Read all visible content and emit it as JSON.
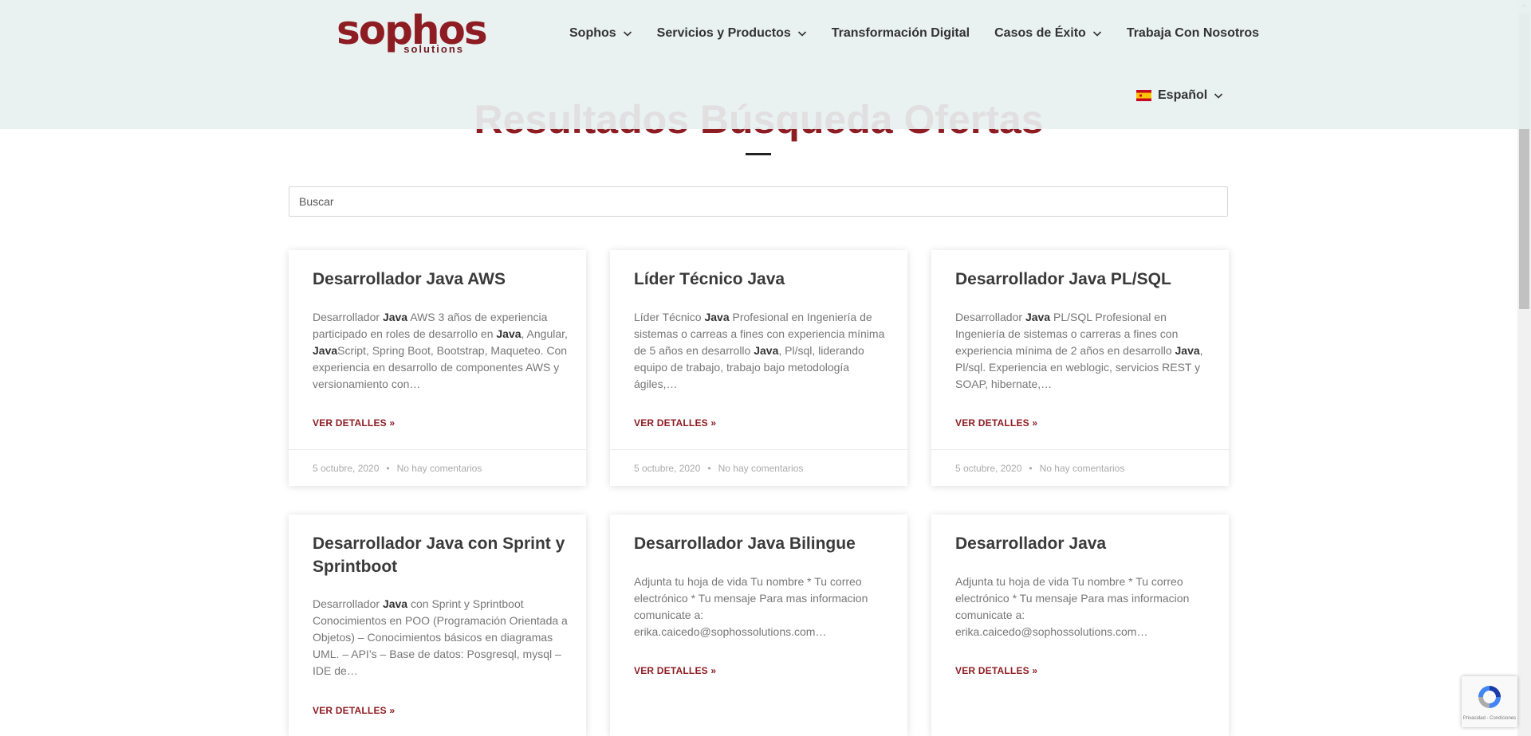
{
  "header": {
    "logo_text": "sophos",
    "logo_subtext": "solutions",
    "nav": [
      {
        "label": "Sophos",
        "dropdown": true
      },
      {
        "label": "Servicios y Productos",
        "dropdown": true
      },
      {
        "label": "Transformación Digital",
        "dropdown": false
      },
      {
        "label": "Casos de Éxito",
        "dropdown": true
      },
      {
        "label": "Trabaja Con Nosotros",
        "dropdown": false
      }
    ],
    "language": "Español"
  },
  "page": {
    "title": "Resultados Búsqueda Ofertas"
  },
  "search": {
    "placeholder": "Buscar"
  },
  "cards": [
    {
      "title": "Desarrollador Java AWS",
      "excerpt": [
        {
          "t": "Desarrollador "
        },
        {
          "t": "Java",
          "b": true
        },
        {
          "t": " AWS 3 años de experiencia participado en roles de desarrollo en "
        },
        {
          "t": "Java",
          "b": true
        },
        {
          "t": ", Angular, "
        },
        {
          "t": "Java",
          "b": true
        },
        {
          "t": "Script, Spring Boot, Bootstrap, Maqueteo. Con experiencia en desarrollo de componentes AWS y versionamiento con…"
        }
      ],
      "read_more": "VER DETALLES »",
      "date": "5 octubre, 2020",
      "comments": "No hay comentarios"
    },
    {
      "title": "Líder Técnico Java",
      "excerpt": [
        {
          "t": "Líder Técnico "
        },
        {
          "t": "Java",
          "b": true
        },
        {
          "t": " Profesional en Ingeniería de sistemas o carreas a fines con experiencia mínima de 5 años en desarrollo "
        },
        {
          "t": "Java",
          "b": true
        },
        {
          "t": ", Pl/sql, liderando equipo de trabajo, trabajo bajo metodología ágiles,…"
        }
      ],
      "read_more": "VER DETALLES »",
      "date": "5 octubre, 2020",
      "comments": "No hay comentarios"
    },
    {
      "title": "Desarrollador Java PL/SQL",
      "excerpt": [
        {
          "t": "Desarrollador "
        },
        {
          "t": "Java",
          "b": true
        },
        {
          "t": " PL/SQL Profesional en Ingeniería de sistemas o carreras a fines con experiencia mínima de 2 años en desarrollo "
        },
        {
          "t": "Java",
          "b": true
        },
        {
          "t": ", Pl/sql. Experiencia en weblogic, servicios REST y SOAP, hibernate,…"
        }
      ],
      "read_more": "VER DETALLES »",
      "date": "5 octubre, 2020",
      "comments": "No hay comentarios"
    },
    {
      "title": "Desarrollador Java con Sprint y Sprintboot",
      "excerpt": [
        {
          "t": "Desarrollador "
        },
        {
          "t": "Java",
          "b": true
        },
        {
          "t": " con Sprint y Sprintboot Conocimientos en POO (Programación Orientada a Objetos) – Conocimientos básicos en diagramas UML. – API’s – Base de datos: Posgresql, mysql – IDE de…"
        }
      ],
      "read_more": "VER DETALLES »"
    },
    {
      "title": "Desarrollador Java Bilingue",
      "excerpt": [
        {
          "t": "Adjunta tu hoja de vida Tu nombre * Tu correo electrónico * Tu mensaje Para mas informacion comunicate a: erika.caicedo@sophossolutions.com…"
        }
      ],
      "read_more": "VER DETALLES »"
    },
    {
      "title": "Desarrollador Java",
      "excerpt": [
        {
          "t": "Adjunta tu hoja de vida Tu nombre * Tu correo electrónico * Tu mensaje Para mas informacion comunicate a: erika.caicedo@sophossolutions.com…"
        }
      ],
      "read_more": "VER DETALLES »"
    }
  ],
  "recaptcha": {
    "links": "Privacidad - Condiciones"
  },
  "colors": {
    "brand": "#8e1c23",
    "header_bg": "#e8f0f0",
    "text_dark": "#333333",
    "text_muted": "#777777"
  }
}
